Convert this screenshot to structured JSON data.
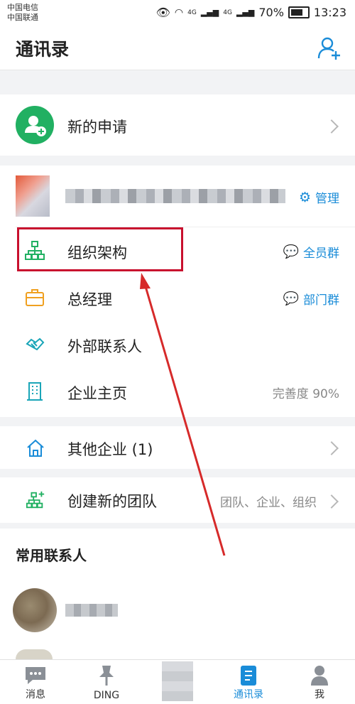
{
  "status_bar": {
    "carrier_1": "中国电信",
    "carrier_2": "中国联通",
    "network_1": "4G",
    "network_2": "4G",
    "battery": "70%",
    "time": "13:23"
  },
  "header": {
    "title": "通讯录"
  },
  "new_request": {
    "label": "新的申请"
  },
  "org": {
    "manage_label": "管理",
    "rows": [
      {
        "label": "组织架构",
        "action": "全员群"
      },
      {
        "label": "总经理",
        "action": "部门群"
      },
      {
        "label": "外部联系人"
      },
      {
        "label": "企业主页",
        "value": "完善度 90%"
      }
    ]
  },
  "other_company": {
    "label": "其他企业 (1)"
  },
  "create_team": {
    "label": "创建新的团队",
    "hint": "团队、企业、组织"
  },
  "frequent": {
    "title": "常用联系人"
  },
  "tabbar": {
    "items": [
      {
        "label": "消息"
      },
      {
        "label": "DING"
      },
      {
        "label": ""
      },
      {
        "label": "通讯录"
      },
      {
        "label": "我"
      }
    ]
  },
  "colors": {
    "accent": "#1a8cd8",
    "green": "#21b062",
    "highlight_box": "#c8102e",
    "annotation_arrow": "#d62a2a"
  }
}
